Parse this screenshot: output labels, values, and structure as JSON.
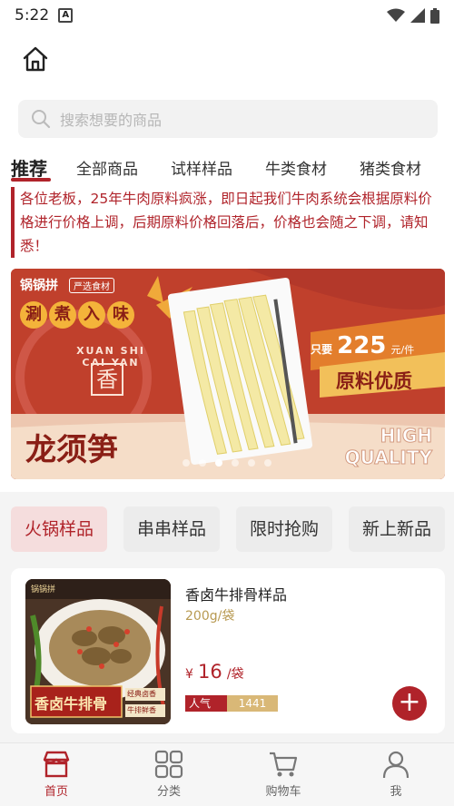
{
  "status_bar": {
    "time": "5:22",
    "a_icon": "A"
  },
  "search": {
    "placeholder": "搜索想要的商品"
  },
  "categories": [
    "推荐",
    "全部商品",
    "试样样品",
    "牛类食材",
    "猪类食材"
  ],
  "notice": "各位老板，25年牛肉原料疯涨，即日起我们牛肉系统会根据原料价格进行价格上调，后期原料价格回落后，价格也会随之下调，请知悉！",
  "banner": {
    "brand": "锅锅拼",
    "brand_tag": "严选食材",
    "badge_chars": [
      "涮",
      "煮",
      "入",
      "味"
    ],
    "price_prefix": "只要",
    "price": "225",
    "price_unit": "元/件",
    "quality": "原料优质",
    "product": "龙须笋",
    "english_1": "HIGH",
    "english_2": "QUALITY",
    "stamp_text": "XUAN SHI CAI YAN",
    "stamp_char": "香",
    "dots_total": 6,
    "dots_active": 2
  },
  "subtabs": [
    "火锅样品",
    "串串样品",
    "限时抢购",
    "新上新品"
  ],
  "product": {
    "name": "香卤牛排骨样品",
    "spec": "200g/袋",
    "currency": "¥",
    "price": "16",
    "unit": "/袋",
    "pop_label": "人气",
    "pop_count": "1441",
    "thumb_title": "香卤牛排骨",
    "thumb_brand": "锅锅拼",
    "thumb_tag1": "经典卤香",
    "thumb_tag2": "牛排鲜香"
  },
  "nav": [
    "首页",
    "分类",
    "购物车",
    "我"
  ],
  "colors": {
    "accent": "#b0232a",
    "gold": "#d9b877"
  }
}
